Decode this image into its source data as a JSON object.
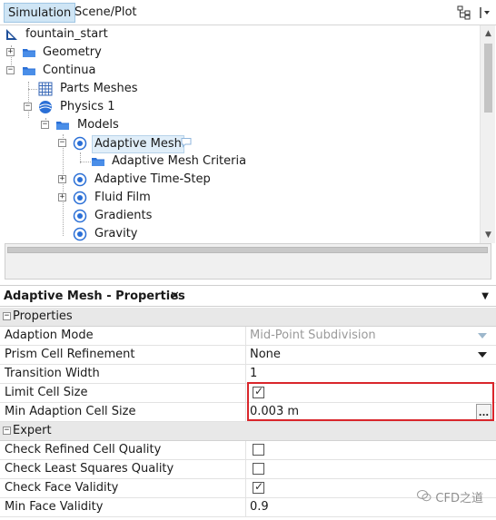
{
  "tabs": [
    {
      "label": "Simulation",
      "active": true
    },
    {
      "label": "Scene/Plot",
      "active": false
    }
  ],
  "tree": {
    "root": "fountain_start",
    "geometry": "Geometry",
    "continua": "Continua",
    "parts_meshes": "Parts Meshes",
    "physics": "Physics 1",
    "models": "Models",
    "adaptive_mesh": "Adaptive Mesh",
    "adaptive_mesh_criteria": "Adaptive Mesh Criteria",
    "adaptive_time_step": "Adaptive Time-Step",
    "fluid_film": "Fluid Film",
    "gradients": "Gradients",
    "gravity": "Gravity"
  },
  "properties_panel": {
    "title": "Adaptive Mesh - Properties",
    "close_glyph": "✕",
    "menu_glyph": "▼",
    "sections": {
      "properties": "Properties",
      "expert": "Expert"
    },
    "rows": {
      "adaptation_mode": {
        "name": "Adaption Mode",
        "value": "Mid-Point Subdivision"
      },
      "prism_refinement": {
        "name": "Prism Cell Refinement",
        "value": "None"
      },
      "transition_width": {
        "name": "Transition Width",
        "value": "1"
      },
      "limit_cell_size": {
        "name": "Limit Cell Size",
        "checked": true
      },
      "min_adaption_cell_size": {
        "name": "Min Adaption Cell Size",
        "value": "0.003 m",
        "button": "..."
      },
      "check_refined_quality": {
        "name": "Check Refined Cell Quality",
        "checked": false
      },
      "check_least_squares": {
        "name": "Check Least Squares Quality",
        "checked": false
      },
      "check_face_validity": {
        "name": "Check Face Validity",
        "checked": true
      },
      "min_face_validity": {
        "name": "Min Face Validity",
        "value": "0.9"
      }
    }
  },
  "watermark": "CFD之道",
  "colors": {
    "selection_bg": "#cfe5f5",
    "highlight_border": "#d9262b",
    "folder_blue": "#2a6fd6"
  }
}
